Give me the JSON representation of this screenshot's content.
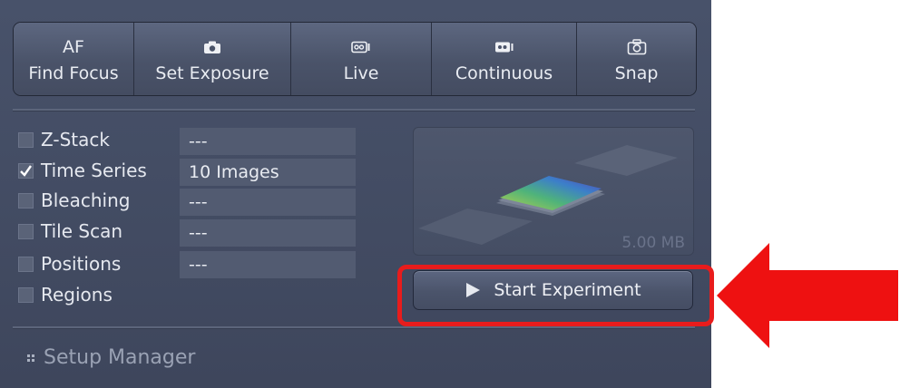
{
  "toolbar": {
    "buttons": [
      {
        "top": "AF",
        "label": "Find Focus",
        "icon": "af-text"
      },
      {
        "top": "",
        "label": "Set Exposure",
        "icon": "camera-icon"
      },
      {
        "top": "",
        "label": "Live",
        "icon": "video-camera-icon"
      },
      {
        "top": "",
        "label": "Continuous",
        "icon": "video-camera-icon"
      },
      {
        "top": "",
        "label": "Snap",
        "icon": "snapshot-camera-icon"
      }
    ]
  },
  "options": [
    {
      "label": "Z-Stack",
      "checked": false,
      "value": "---"
    },
    {
      "label": "Time Series",
      "checked": true,
      "value": "10 Images"
    },
    {
      "label": "Bleaching",
      "checked": false,
      "value": "---"
    },
    {
      "label": "Tile Scan",
      "checked": false,
      "value": "---"
    },
    {
      "label": "Positions",
      "checked": false,
      "value": "---"
    },
    {
      "label": "Regions",
      "checked": false,
      "value": ""
    }
  ],
  "preview": {
    "size": "5.00 MB"
  },
  "start_button": {
    "label": "Start Experiment",
    "icon": "play-icon"
  },
  "setup_manager": {
    "label": "Setup Manager",
    "icon": "grip-icon"
  },
  "colors": {
    "highlight": "#e81c1c",
    "panel": "#454e64"
  }
}
